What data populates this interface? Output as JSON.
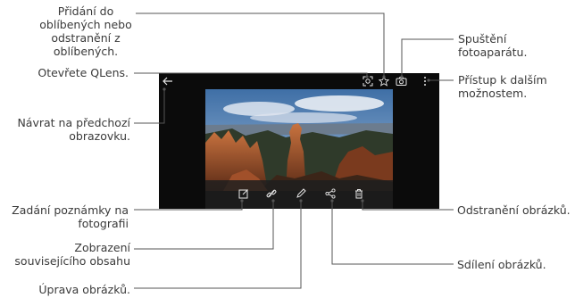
{
  "callouts": {
    "favorite": "Přidání do\noblíbených nebo\nodstranění z\noblíbených.",
    "qlens": "Otevřete QLens.",
    "back": "Návrat na předchozí\nobrazovku.",
    "note": "Zadání poznámky na\nfotografii",
    "related": "Zobrazení\nsouvisejícího obsahu",
    "edit": "Úprava obrázků.",
    "camera": "Spuštění\nfotoaparátu.",
    "more": "Přístup k dalším\nmožnostem.",
    "delete": "Odstranění obrázků.",
    "share": "Sdílení obrázků."
  },
  "icons": {
    "back": "arrow-left-icon",
    "qlens": "qlens-icon",
    "favorite": "star-icon",
    "camera": "camera-icon",
    "more": "more-vertical-icon",
    "note": "note-icon",
    "related": "link-icon",
    "edit": "pencil-icon",
    "share": "share-icon",
    "delete": "trash-icon"
  },
  "colors": {
    "leader_line": "#555555",
    "screen_bg": "#0b0b0b",
    "sky": "#5a86b8",
    "rock": "#b5603a"
  }
}
